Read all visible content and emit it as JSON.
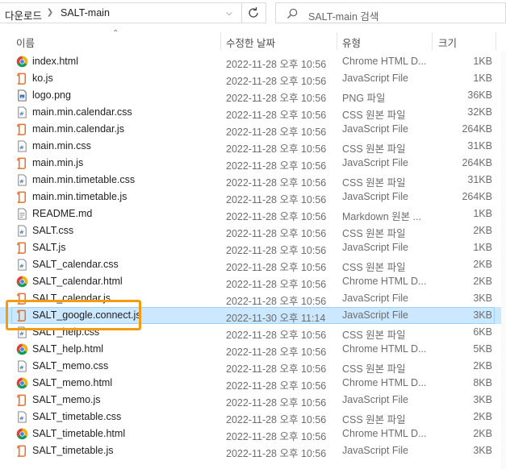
{
  "address_bar": {
    "crumb_parent": "다운로드",
    "crumb_current": "SALT-main"
  },
  "search": {
    "placeholder": "SALT-main 검색"
  },
  "columns": {
    "name": "이름",
    "date": "수정한 날짜",
    "type": "유형",
    "size": "크기"
  },
  "files": [
    {
      "name": "index.html",
      "date": "2022-11-28 오후 10:56",
      "type": "Chrome HTML D...",
      "size": "1KB",
      "icon": "chrome-icon"
    },
    {
      "name": "ko.js",
      "date": "2022-11-28 오후 10:56",
      "type": "JavaScript File",
      "size": "1KB",
      "icon": "js-file-icon"
    },
    {
      "name": "logo.png",
      "date": "2022-11-28 오후 10:56",
      "type": "PNG 파일",
      "size": "36KB",
      "icon": "image-file-icon"
    },
    {
      "name": "main.min.calendar.css",
      "date": "2022-11-28 오후 10:56",
      "type": "CSS 원본 파일",
      "size": "32KB",
      "icon": "css-file-icon"
    },
    {
      "name": "main.min.calendar.js",
      "date": "2022-11-28 오후 10:56",
      "type": "JavaScript File",
      "size": "264KB",
      "icon": "js-file-icon"
    },
    {
      "name": "main.min.css",
      "date": "2022-11-28 오후 10:56",
      "type": "CSS 원본 파일",
      "size": "31KB",
      "icon": "css-file-icon"
    },
    {
      "name": "main.min.js",
      "date": "2022-11-28 오후 10:56",
      "type": "JavaScript File",
      "size": "264KB",
      "icon": "js-file-icon"
    },
    {
      "name": "main.min.timetable.css",
      "date": "2022-11-28 오후 10:56",
      "type": "CSS 원본 파일",
      "size": "31KB",
      "icon": "css-file-icon"
    },
    {
      "name": "main.min.timetable.js",
      "date": "2022-11-28 오후 10:56",
      "type": "JavaScript File",
      "size": "264KB",
      "icon": "js-file-icon"
    },
    {
      "name": "README.md",
      "date": "2022-11-28 오후 10:56",
      "type": "Markdown 원본 ...",
      "size": "1KB",
      "icon": "text-file-icon"
    },
    {
      "name": "SALT.css",
      "date": "2022-11-28 오후 10:56",
      "type": "CSS 원본 파일",
      "size": "2KB",
      "icon": "css-file-icon"
    },
    {
      "name": "SALT.js",
      "date": "2022-11-28 오후 10:56",
      "type": "JavaScript File",
      "size": "1KB",
      "icon": "js-file-icon"
    },
    {
      "name": "SALT_calendar.css",
      "date": "2022-11-28 오후 10:56",
      "type": "CSS 원본 파일",
      "size": "2KB",
      "icon": "css-file-icon"
    },
    {
      "name": "SALT_calendar.html",
      "date": "2022-11-28 오후 10:56",
      "type": "Chrome HTML D...",
      "size": "2KB",
      "icon": "chrome-icon"
    },
    {
      "name": "SALT_calendar.js",
      "date": "2022-11-28 오후 10:56",
      "type": "JavaScript File",
      "size": "3KB",
      "icon": "js-file-icon"
    },
    {
      "name": "SALT_google.connect.js",
      "date": "2022-11-30 오후 11:14",
      "type": "JavaScript File",
      "size": "3KB",
      "icon": "js-file-icon",
      "selected": true
    },
    {
      "name": "SALT_help.css",
      "date": "2022-11-28 오후 10:56",
      "type": "CSS 원본 파일",
      "size": "6KB",
      "icon": "css-file-icon"
    },
    {
      "name": "SALT_help.html",
      "date": "2022-11-28 오후 10:56",
      "type": "Chrome HTML D...",
      "size": "5KB",
      "icon": "chrome-icon"
    },
    {
      "name": "SALT_memo.css",
      "date": "2022-11-28 오후 10:56",
      "type": "CSS 원본 파일",
      "size": "2KB",
      "icon": "css-file-icon"
    },
    {
      "name": "SALT_memo.html",
      "date": "2022-11-28 오후 10:56",
      "type": "Chrome HTML D...",
      "size": "8KB",
      "icon": "chrome-icon"
    },
    {
      "name": "SALT_memo.js",
      "date": "2022-11-28 오후 10:56",
      "type": "JavaScript File",
      "size": "3KB",
      "icon": "js-file-icon"
    },
    {
      "name": "SALT_timetable.css",
      "date": "2022-11-28 오후 10:56",
      "type": "CSS 원본 파일",
      "size": "2KB",
      "icon": "css-file-icon"
    },
    {
      "name": "SALT_timetable.html",
      "date": "2022-11-28 오후 10:56",
      "type": "Chrome HTML D...",
      "size": "2KB",
      "icon": "chrome-icon"
    },
    {
      "name": "SALT_timetable.js",
      "date": "2022-11-28 오후 10:56",
      "type": "JavaScript File",
      "size": "3KB",
      "icon": "js-file-icon"
    }
  ],
  "colors": {
    "selection": "#cce8ff",
    "highlight_box": "#f39c12",
    "js_icon": "#e8702a",
    "chrome_red": "#db4437"
  }
}
